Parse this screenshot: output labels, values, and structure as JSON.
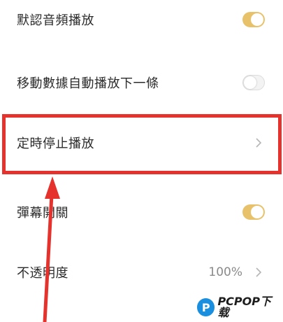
{
  "settings": {
    "items": [
      {
        "label": "默認音頻播放",
        "control": "toggle",
        "state": "on"
      },
      {
        "label": "移動數據自動播放下一條",
        "control": "toggle",
        "state": "off"
      },
      {
        "label": "定時停止播放",
        "control": "chevron"
      },
      {
        "label": "彈幕開關",
        "control": "toggle",
        "state": "on"
      },
      {
        "label": "不透明度",
        "control": "chevron",
        "value": "100%"
      }
    ]
  },
  "annotation": {
    "highlight_color": "#e5322d",
    "arrow_color": "#e5322d"
  },
  "colors": {
    "toggle_on": "#e8c26a",
    "toggle_off": "#f3f3f3"
  },
  "watermark": {
    "text": "PCPOP下载",
    "icon": "pcpop-logo-icon"
  }
}
